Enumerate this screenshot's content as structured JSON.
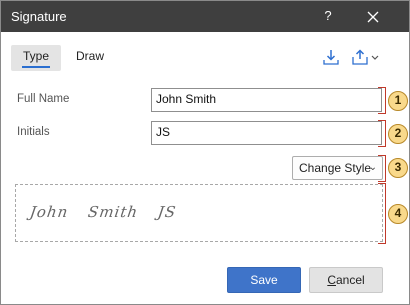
{
  "dialog": {
    "title": "Signature",
    "help_label": "?"
  },
  "tabs": [
    {
      "label": "Type",
      "active": true
    },
    {
      "label": "Draw",
      "active": false
    }
  ],
  "toolbar": {
    "import_icon": "import-icon",
    "export_icon": "export-icon"
  },
  "form": {
    "full_name_label": "Full Name",
    "full_name_value": "John Smith",
    "initials_label": "Initials",
    "initials_value": "JS",
    "change_style_label": "Change Style"
  },
  "preview": {
    "text": "John Smith JS"
  },
  "callouts": [
    "1",
    "2",
    "3",
    "4"
  ],
  "buttons": {
    "save_label": "Save",
    "cancel_label_accel": "C",
    "cancel_label_rest": "ancel"
  },
  "colors": {
    "titlebar": "#3f3f3f",
    "accent": "#3f74c9",
    "callout_bracket": "#c0392b",
    "callout_badge": "#f9d98b"
  }
}
